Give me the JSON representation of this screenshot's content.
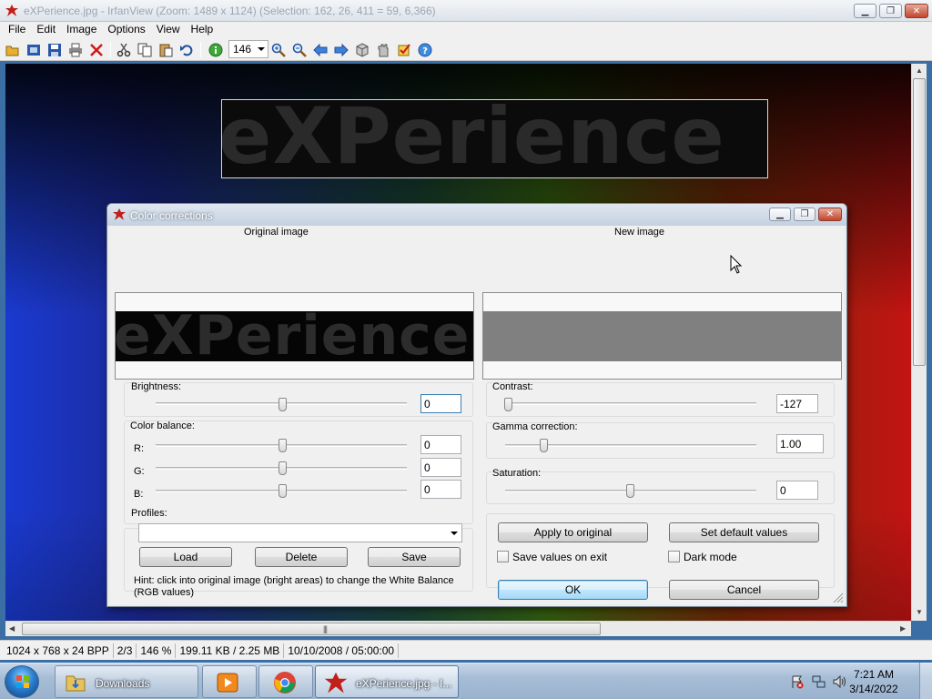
{
  "main_window": {
    "title": "eXPerience.jpg - IrfanView (Zoom: 1489 x 1124) (Selection: 162, 26, 411 = 59, 6,366)",
    "menu": [
      "File",
      "Edit",
      "Image",
      "Options",
      "View",
      "Help"
    ],
    "zoom_value": "146",
    "canvas_text": "eXPerience"
  },
  "status_bar": {
    "dimensions": "1024 x 768 x 24 BPP",
    "index": "2/3",
    "zoom": "146 %",
    "size": "199.11 KB / 2.25 MB",
    "date": "10/10/2008 / 05:00:00"
  },
  "dialog": {
    "title": "Color corrections",
    "original_label": "Original image",
    "new_label": "New image",
    "preview_text": "eXPerience",
    "brightness": {
      "label": "Brightness:",
      "value": "0"
    },
    "color_balance": {
      "label": "Color balance:",
      "r": {
        "label": "R:",
        "value": "0"
      },
      "g": {
        "label": "G:",
        "value": "0"
      },
      "b": {
        "label": "B:",
        "value": "0"
      }
    },
    "contrast": {
      "label": "Contrast:",
      "value": "-127"
    },
    "gamma": {
      "label": "Gamma correction:",
      "value": "1.00"
    },
    "saturation": {
      "label": "Saturation:",
      "value": "0"
    },
    "profiles": {
      "label": "Profiles:",
      "selected": ""
    },
    "buttons": {
      "load": "Load",
      "delete": "Delete",
      "save": "Save",
      "apply": "Apply to original",
      "set_default": "Set default values",
      "ok": "OK",
      "cancel": "Cancel"
    },
    "save_on_exit": {
      "label": "Save values on exit",
      "checked": false
    },
    "dark_mode": {
      "label": "Dark mode",
      "checked": false
    },
    "hint": "Hint: click into original image (bright areas) to change the White Balance (RGB values)"
  },
  "taskbar": {
    "items": [
      {
        "label": "Downloads"
      },
      {
        "label": ""
      },
      {
        "label": ""
      },
      {
        "label": "eXPerience.jpg - I..."
      }
    ],
    "clock_time": "7:21 AM",
    "clock_date": "3/14/2022"
  },
  "colors": {
    "dialog_bg": "#f0f0f0",
    "default_button": "#bee6fd",
    "irfanview_red": "#c0201a"
  }
}
